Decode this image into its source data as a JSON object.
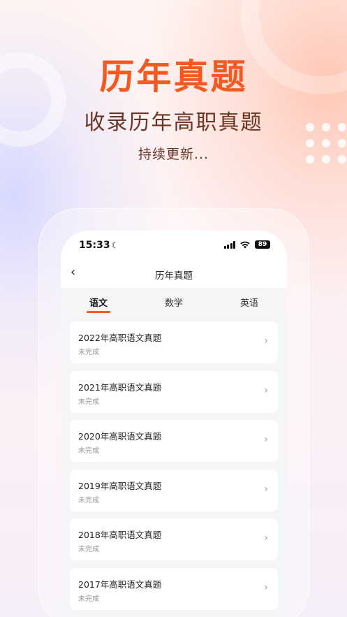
{
  "promo": {
    "headline": "历年真题",
    "subhead": "收录历年高职真题",
    "tagline": "持续更新..."
  },
  "status_bar": {
    "time": "15:33",
    "battery": "89",
    "icons": [
      "moon-icon",
      "signal-icon",
      "wifi-icon",
      "battery-icon"
    ]
  },
  "nav": {
    "back_icon": "chevron-left-icon",
    "title": "历年真题"
  },
  "tabs": [
    {
      "label": "语文",
      "active": true
    },
    {
      "label": "数学",
      "active": false
    },
    {
      "label": "英语",
      "active": false
    }
  ],
  "exams": [
    {
      "title": "2022年高职语文真题",
      "status": "未完成"
    },
    {
      "title": "2021年高职语文真题",
      "status": "未完成"
    },
    {
      "title": "2020年高职语文真题",
      "status": "未完成"
    },
    {
      "title": "2019年高职语文真题",
      "status": "未完成"
    },
    {
      "title": "2018年高职语文真题",
      "status": "未完成"
    },
    {
      "title": "2017年高职语文真题",
      "status": "未完成"
    }
  ],
  "colors": {
    "accent": "#f25a22",
    "subtitle": "#6b3524"
  }
}
